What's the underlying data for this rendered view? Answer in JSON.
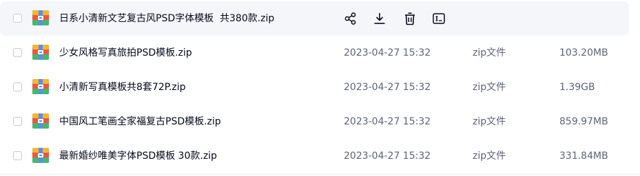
{
  "files": [
    {
      "name": "日系小清新文艺复古风PSD字体模板  共380款.zip",
      "date": "",
      "type": "",
      "size": "",
      "hovered": true
    },
    {
      "name": "少女风格写真旅拍PSD模板.zip",
      "date": "2023-04-27 15:32",
      "type": "zip文件",
      "size": "103.20MB",
      "hovered": false
    },
    {
      "name": "小清新写真模板共8套72P.zip",
      "date": "2023-04-27 15:32",
      "type": "zip文件",
      "size": "1.39GB",
      "hovered": false
    },
    {
      "name": "中国风工笔画全家福复古PSD模板.zip",
      "date": "2023-04-27 15:32",
      "type": "zip文件",
      "size": "859.97MB",
      "hovered": false
    },
    {
      "name": "最新婚纱唯美字体PSD模板 30款.zip",
      "date": "2023-04-27 15:32",
      "type": "zip文件",
      "size": "331.84MB",
      "hovered": false
    }
  ],
  "row_actions": [
    {
      "icon": "share-icon"
    },
    {
      "icon": "download-icon"
    },
    {
      "icon": "delete-icon"
    },
    {
      "icon": "rename-icon"
    }
  ],
  "colors": {
    "hover_background": "#f5f6fa",
    "primary_text": "#03081a",
    "secondary_text": "#5b6378",
    "icon_stroke": "#03081a"
  }
}
